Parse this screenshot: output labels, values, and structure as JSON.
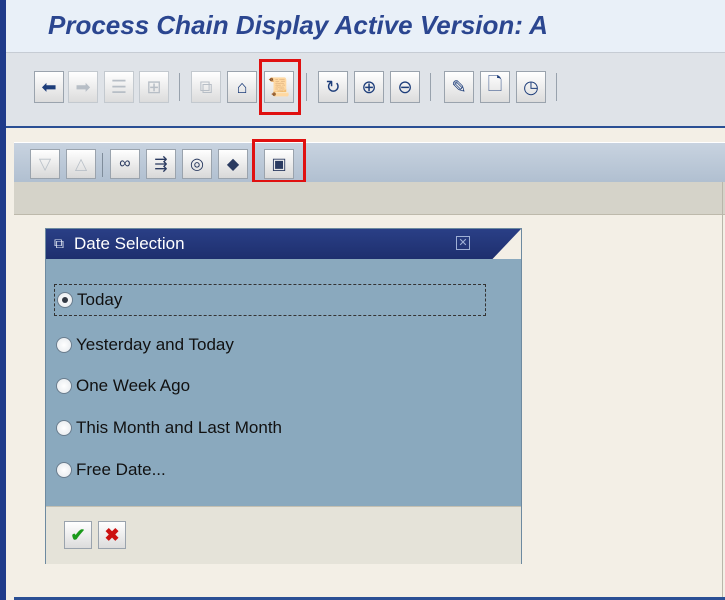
{
  "window": {
    "title": "Process Chain Display Active Version: A"
  },
  "toolbar": {
    "buttons": [
      {
        "name": "back-arrow-icon",
        "glyph": "⬅"
      },
      {
        "name": "forward-arrow-icon",
        "glyph": "➡"
      },
      {
        "name": "list-view-icon",
        "glyph": "☰"
      },
      {
        "name": "tree-view-icon",
        "glyph": "⊞"
      },
      {
        "name": "overview-icon",
        "glyph": "⧉"
      },
      {
        "name": "planning-view-icon",
        "glyph": "⌂"
      },
      {
        "name": "log-view-icon",
        "glyph": "📜"
      },
      {
        "name": "refresh-icon",
        "glyph": "↻"
      },
      {
        "name": "zoom-in-icon",
        "glyph": "⊕"
      },
      {
        "name": "zoom-out-icon",
        "glyph": "⊖"
      },
      {
        "name": "edit-pencil-icon",
        "glyph": "✎"
      },
      {
        "name": "new-document-icon",
        "glyph": "🗋"
      },
      {
        "name": "schedule-clock-icon",
        "glyph": "◷"
      }
    ]
  },
  "subtoolbar": {
    "buttons": [
      {
        "name": "expand-down-icon",
        "glyph": "▽"
      },
      {
        "name": "collapse-up-icon",
        "glyph": "△"
      },
      {
        "name": "link-chain-icon",
        "glyph": "∞"
      },
      {
        "name": "process-flow-icon",
        "glyph": "⇶"
      },
      {
        "name": "target-icon",
        "glyph": "◎"
      },
      {
        "name": "package-icon",
        "glyph": "◆"
      },
      {
        "name": "date-selection-icon",
        "glyph": "▣"
      }
    ]
  },
  "dialog": {
    "title": "Date Selection",
    "options": [
      {
        "label": "Today",
        "selected": true
      },
      {
        "label": "Yesterday and Today",
        "selected": false
      },
      {
        "label": "One Week Ago",
        "selected": false
      },
      {
        "label": "This Month and Last Month",
        "selected": false
      },
      {
        "label": "Free Date...",
        "selected": false
      }
    ],
    "confirm_glyph": "✔",
    "cancel_glyph": "✖"
  },
  "colors": {
    "title_text": "#2b4690",
    "highlight": "#e01010",
    "dialog_header": "#1e2f6e",
    "dialog_body": "#8aa9be",
    "confirm": "#1a9a1a",
    "cancel": "#cc1111"
  }
}
